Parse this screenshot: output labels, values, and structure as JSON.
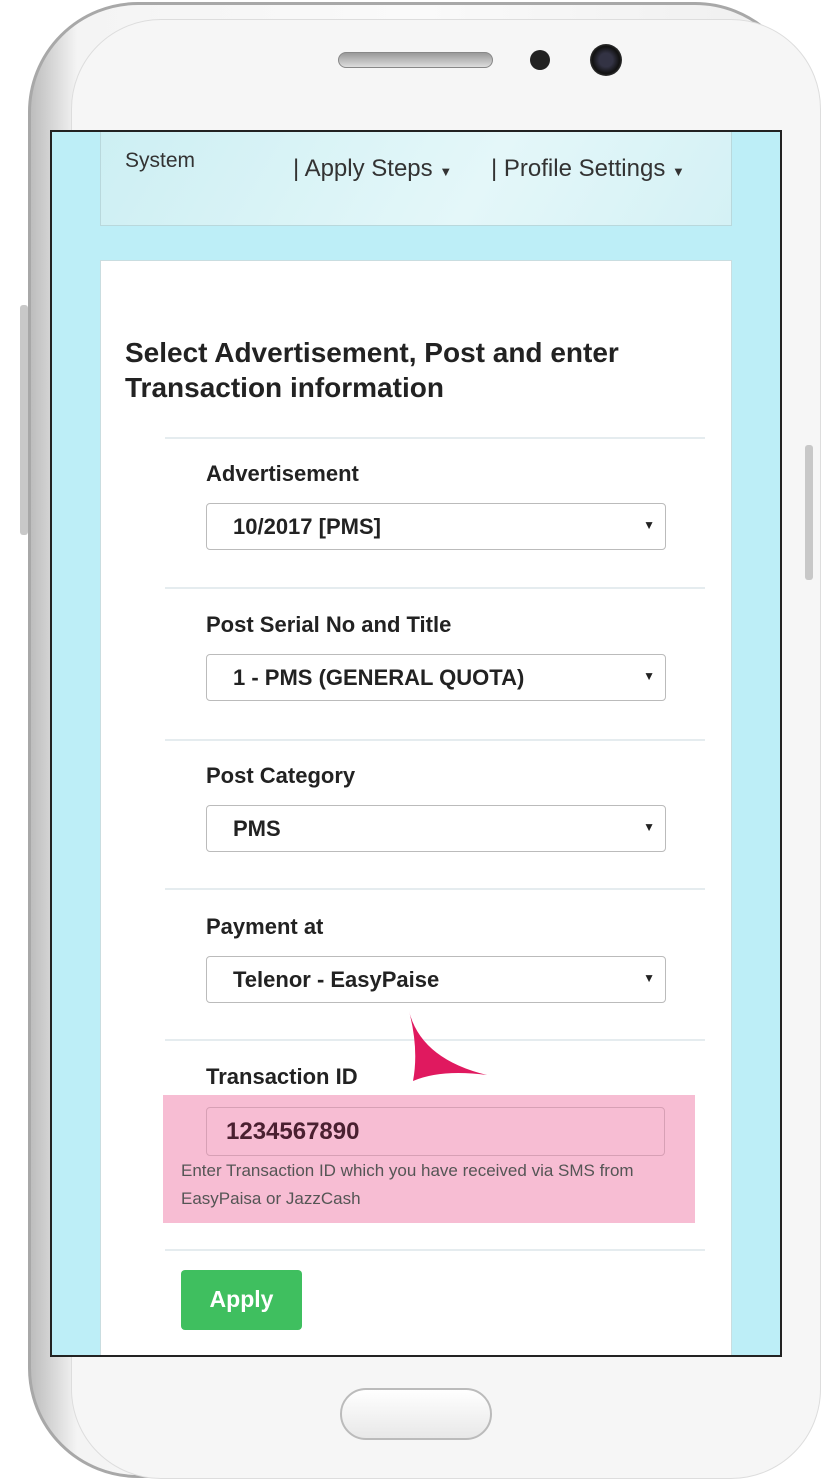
{
  "nav": {
    "brand": "System",
    "items": [
      {
        "label": "Apply Steps"
      },
      {
        "label": "Profile Settings"
      }
    ]
  },
  "form": {
    "title": "Select Advertisement, Post and enter Transaction information",
    "fields": [
      {
        "label": "Advertisement",
        "value": "10/2017 [PMS]"
      },
      {
        "label": "Post Serial No and Title",
        "value": "1 - PMS (GENERAL QUOTA)"
      },
      {
        "label": "Post Category",
        "value": "PMS"
      },
      {
        "label": "Payment at",
        "value": "Telenor - EasyPaise"
      }
    ],
    "transaction": {
      "label": "Transaction ID",
      "value": "1234567890",
      "help": "Enter Transaction ID which you have received via SMS from EasyPaisa or JazzCash"
    },
    "apply_label": "Apply"
  },
  "colors": {
    "accent_green": "#3fbf5f",
    "highlight_pink": "#f7bdd3",
    "arrow": "#e0195f",
    "background": "#bdeef7"
  }
}
